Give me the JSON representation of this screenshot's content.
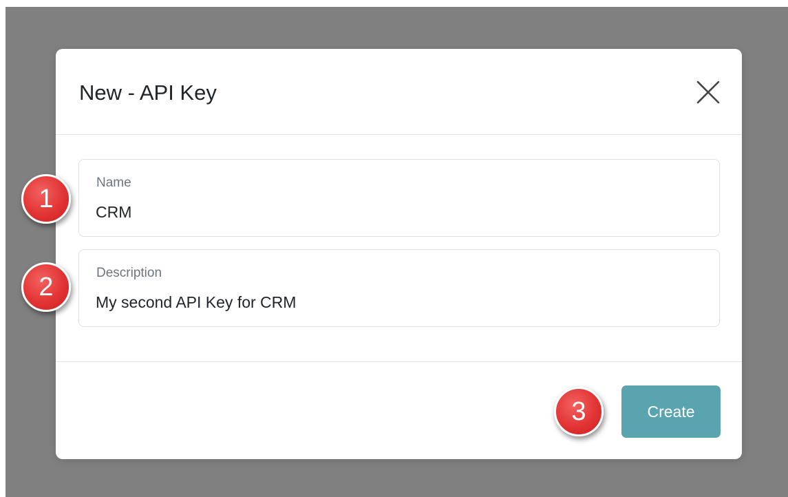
{
  "modal": {
    "title": "New - API Key",
    "close_icon": "close-icon"
  },
  "form": {
    "name": {
      "label": "Name",
      "value": "CRM"
    },
    "description": {
      "label": "Description",
      "value": "My second API Key for CRM"
    }
  },
  "footer": {
    "create_label": "Create"
  },
  "annotations": {
    "step1": "1",
    "step2": "2",
    "step3": "3"
  },
  "colors": {
    "backdrop": "#808080",
    "primary_button": "#5aa4b0",
    "badge": "#e23434",
    "border": "#dee2e6"
  }
}
